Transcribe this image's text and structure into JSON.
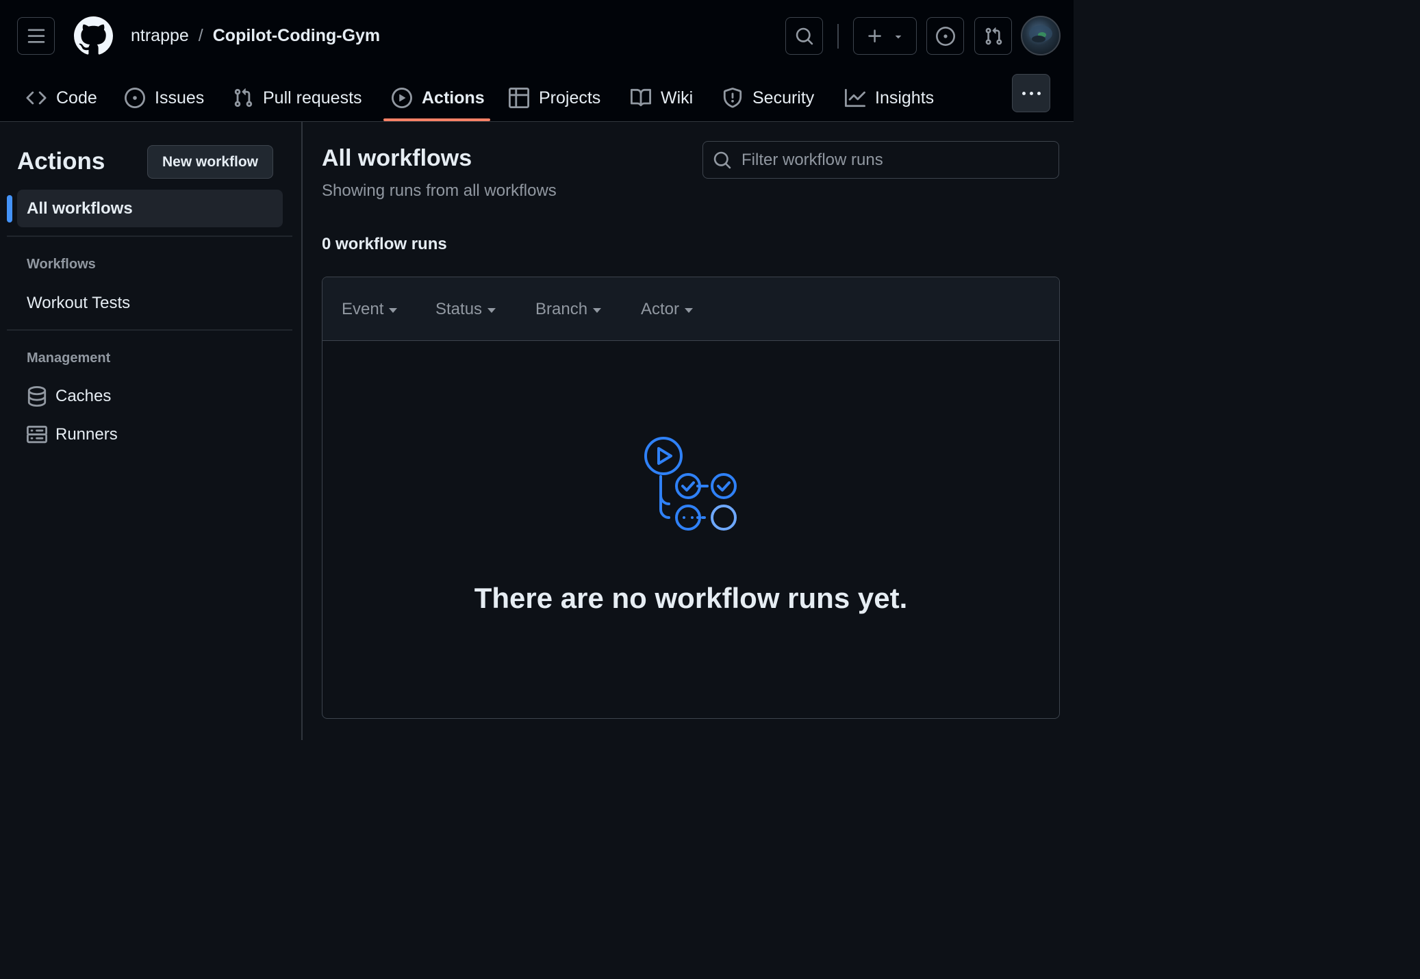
{
  "header": {
    "repo_owner": "ntrappe",
    "repo_separator": "/",
    "repo_name": "Copilot-Coding-Gym",
    "icons": [
      "hamburger-icon",
      "github-logo",
      "search-icon",
      "plus-icon",
      "issue-opened-icon",
      "git-pull-request-icon",
      "kebab-icon"
    ]
  },
  "tabs": [
    {
      "label": "Code",
      "icon": "code-icon"
    },
    {
      "label": "Issues",
      "icon": "issue-opened-icon"
    },
    {
      "label": "Pull requests",
      "icon": "git-pull-request-icon"
    },
    {
      "label": "Actions",
      "icon": "play-icon",
      "active": true
    },
    {
      "label": "Projects",
      "icon": "table-icon"
    },
    {
      "label": "Wiki",
      "icon": "book-icon"
    },
    {
      "label": "Security",
      "icon": "shield-icon"
    },
    {
      "label": "Insights",
      "icon": "graph-icon"
    }
  ],
  "sidebar": {
    "title": "Actions",
    "new_workflow_label": "New workflow",
    "all_workflows_label": "All workflows",
    "workflows_heading": "Workflows",
    "workflows": [
      "Workout Tests"
    ],
    "management_heading": "Management",
    "management_items": [
      {
        "label": "Caches",
        "icon": "database-icon"
      },
      {
        "label": "Runners",
        "icon": "server-icon"
      }
    ]
  },
  "main": {
    "title": "All workflows",
    "subtitle": "Showing runs from all workflows",
    "filter_placeholder": "Filter workflow runs",
    "runs_count": "0 workflow runs",
    "filters": [
      "Event",
      "Status",
      "Branch",
      "Actor"
    ],
    "empty_message": "There are no workflow runs yet."
  },
  "colors": {
    "accent_blue": "#4493f8",
    "active_tab_underline": "#f78166",
    "header_bg": "#010409",
    "page_bg": "#0d1117"
  }
}
